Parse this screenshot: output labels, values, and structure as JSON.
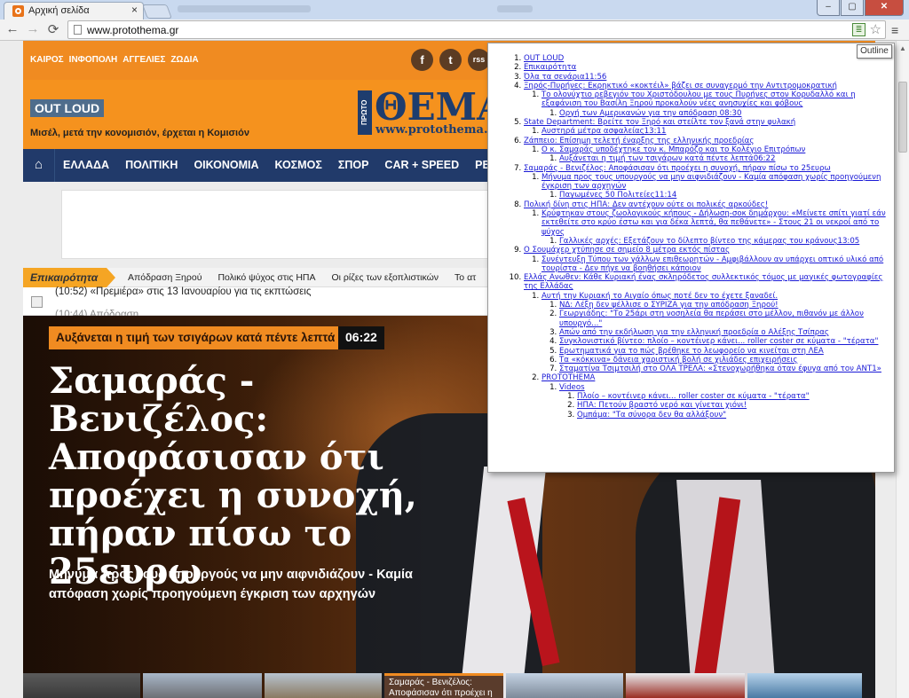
{
  "browser": {
    "tab_title": "Αρχική σελίδα",
    "tab_close": "×",
    "url": "www.protothema.gr",
    "tooltip": "Outline",
    "back_glyph": "←",
    "forward_glyph": "→",
    "reload_glyph": "⟳",
    "star_glyph": "☆",
    "menu_glyph": "≡",
    "min_glyph": "–",
    "max_glyph": "▢",
    "close_glyph": "✕"
  },
  "site": {
    "top_links": [
      "ΚΑΙΡΟΣ",
      "ΙΝΦΟΠΟΛΗ",
      "ΑΓΓΕΛΙΕΣ",
      "ΖΩΔΙΑ"
    ],
    "social": [
      "f",
      "t",
      "rss",
      "g+"
    ],
    "outloud": "OUT LOUD",
    "outloud_text": "Μισέλ, μετά την κονομισιόν, έρχεται η Κομισιόν",
    "logo_proto": "ΠΡΩΤΟ",
    "logo_thema": "ΘΕΜΑ",
    "logo_web": "www.protothema.gr",
    "home_glyph": "⌂",
    "nav": [
      "ΕΛΛΑΔΑ",
      "ΠΟΛΙΤΙΚΗ",
      "ΟΙΚΟΝΟΜΙΑ",
      "ΚΟΣΜΟΣ",
      "ΣΠΟΡ",
      "CAR + SPEED",
      "PEOPLE"
    ],
    "breaking_label": "Επικαιρότητα",
    "breaking_items": [
      "Απόδραση Ξηρού",
      "Πολικό ψύχος στις ΗΠΑ",
      "Οι ρίζες των εξοπλιστικών",
      "Το ατ"
    ],
    "ticker_1": "(10:52) «Πρεμιέρα» στις 13 Ιανουαρίου για τις εκπτώσεις",
    "ticker_2": "(10:44) Απόδραση...",
    "kicker": "Αυξάνεται η τιμή των τσιγάρων κατά πέντε λεπτά",
    "time": "06:22",
    "headline": "Σαμαράς - Βενιζέλος: Αποφάσισαν ότι προέχει η συνοχή, πήραν πίσω το 25ευρω",
    "subhead": "Μήνυμα προς τους υπουργούς να μην αιφνιδιάζουν - Καμία απόφαση χωρίς προηγούμενη έγκριση των αρχηγών",
    "thumb_caption": "Σαμαράς - Βενιζέλος: Αποφάσισαν ότι προέχει η"
  },
  "outline": [
    {
      "t": "OUT LOUD"
    },
    {
      "t": "Επικαιρότητα"
    },
    {
      "t": "Όλα τα σενάρια11:56"
    },
    {
      "t": "Ξηρός-Πυρήνες: Εκρηκτικό «κοκτέιλ» βάζει σε συναγερμό την Αντιτρομοκρατική",
      "c": [
        {
          "t": "Το ολονύχτιο ρεβεγιόν του Χριστόδουλου με τους Πυρήνες στον Κορυδαλλό και η εξαφάνιση του Βασίλη Ξηρού προκαλούν νέες ανησυχίες και φόβους",
          "c": [
            {
              "t": "Οργή των Αμερικανών για την απόδραση 08:30"
            }
          ]
        }
      ]
    },
    {
      "t": "State Department: Βρείτε τον Ξηρό και στείλτε τον ξανά στην φυλακή",
      "c": [
        {
          "t": "Αυστηρά μέτρα ασφαλείας13:11"
        }
      ]
    },
    {
      "t": "Ζάππειο: Επίσημη τελετή έναρξης της ελληνικής προεδρίας",
      "c": [
        {
          "t": "Ο κ. Σαμαράς υποδέχτηκε τον κ. Μπαρόζο και το Κολέγιο Επιτρόπων",
          "c": [
            {
              "t": "Αυξάνεται η τιμή των τσιγάρων κατά πέντε λεπτά06:22"
            }
          ]
        }
      ]
    },
    {
      "t": "Σαμαράς - Βενιζέλος: Αποφάσισαν ότι προέχει η συνοχή, πήραν πίσω το 25ευρω",
      "c": [
        {
          "t": "Μήνυμα προς τους υπουργούς να μην αιφνιδιάζουν - Καμία απόφαση χωρίς προηγούμενη έγκριση των αρχηγών",
          "c": [
            {
              "t": "Παγωμένες 50 Πολιτείες11:14"
            }
          ]
        }
      ]
    },
    {
      "t": "Πολική δίνη στις ΗΠΑ: Δεν αντέχουν ούτε οι πολικές αρκούδες!",
      "c": [
        {
          "t": "Κρύφτηκαν στους ζωολογικούς κήπους - Δήλωση-σοκ δημάρχου: «Μείνετε σπίτι γιατί εάν εκτεθείτε στο κρύο έστω και για δέκα λεπτά, θα πεθάνετε» - Στους 21 οι νεκροί από το ψύχος",
          "c": [
            {
              "t": "Γαλλικές αρχές: Εξετάζουν το δίλεπτο βίντεο της κάμερας του κράνους13:05"
            }
          ]
        }
      ]
    },
    {
      "t": "Ο Σουμάχερ χτύπησε σε σημείο 8 μέτρα εκτός πίστας",
      "c": [
        {
          "t": "Συνέντευξη Τύπου των γάλλων επιθεωρητών - Αμφιβάλλουν αν υπάρχει οπτικό υλικό από τουρίστα - Δεν πήγε να βοηθήσει κάποιον"
        }
      ]
    },
    {
      "t": "Ελλάς Ανωθεν: Κάθε Κυριακή ένας σκληρόδετος συλλεκτικός τόμος με μαγικές φωτογραφίες της Ελλάδας",
      "c": [
        {
          "t": "Αυτή την Κυριακή το Αιγαίο όπως ποτέ δεν το έχετε ξαναδεί.",
          "c": [
            {
              "t": "ΝΔ: Λέξη δεν ψέλλισε ο ΣΥΡΙΖΑ για την απόδραση Ξηρού!"
            },
            {
              "t": "Γεωργιάδης: \"Το 25άρι στη νοσηλεία θα περάσει στο μέλλον, πιθανόν με άλλον υπουργό...\""
            },
            {
              "t": "Απών από την εκδήλωση για την ελληνική προεδρία ο Αλέξης Τσίπρας"
            },
            {
              "t": "Συγκλονιστικό βίντεο: πλοίο – κοντέινερ κάνει... roller coster σε κύματα - \"τέρατα\""
            },
            {
              "t": "Ερωτηματικά για το πώς βρέθηκε το λεωφορείο να κινείται στη ΛΕΑ"
            },
            {
              "t": "Τα «κόκκινα» δάνεια χαριστική βολή σε χιλιάδες επιχειρήσεις"
            },
            {
              "t": "Σταματίνα Τσιμτσιλή στο ΟΛΑ ΤΡΕΛΑ: «Στενοχωρήθηκα όταν έφυγα από τον ΑΝΤ1»"
            }
          ]
        },
        {
          "t": "PROTOTHEMA",
          "c": [
            {
              "t": "Videos",
              "c": [
                {
                  "t": "Πλοίο – κοντέινερ κάνει... roller coster σε κύματα - \"τέρατα\""
                },
                {
                  "t": "ΗΠΑ: Πετούν βραστό νερό και γίνεται χιόνι!"
                },
                {
                  "t": "Ομπάμα: \"Τα σύνορα δεν θα αλλάξουν\""
                }
              ]
            }
          ]
        }
      ]
    }
  ]
}
